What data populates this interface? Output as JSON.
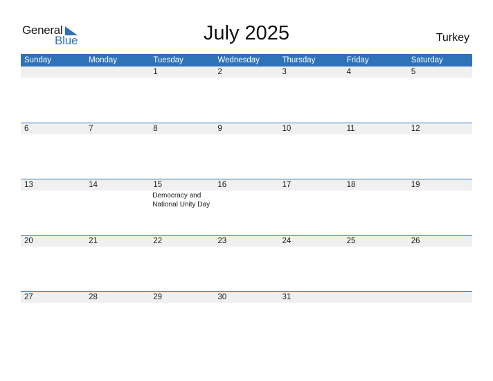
{
  "logo": {
    "general": "General",
    "blue": "Blue"
  },
  "title": "July 2025",
  "country": "Turkey",
  "colors": {
    "accent": "#2e73b8",
    "date_strip": "#f0f0f0"
  },
  "weekdays": [
    "Sunday",
    "Monday",
    "Tuesday",
    "Wednesday",
    "Thursday",
    "Friday",
    "Saturday"
  ],
  "weeks": [
    {
      "days": [
        "",
        "",
        "1",
        "2",
        "3",
        "4",
        "5"
      ],
      "events": [
        "",
        "",
        "",
        "",
        "",
        "",
        ""
      ]
    },
    {
      "days": [
        "6",
        "7",
        "8",
        "9",
        "10",
        "11",
        "12"
      ],
      "events": [
        "",
        "",
        "",
        "",
        "",
        "",
        ""
      ]
    },
    {
      "days": [
        "13",
        "14",
        "15",
        "16",
        "17",
        "18",
        "19"
      ],
      "events": [
        "",
        "",
        "Democracy and National Unity Day",
        "",
        "",
        "",
        ""
      ]
    },
    {
      "days": [
        "20",
        "21",
        "22",
        "23",
        "24",
        "25",
        "26"
      ],
      "events": [
        "",
        "",
        "",
        "",
        "",
        "",
        ""
      ]
    },
    {
      "days": [
        "27",
        "28",
        "29",
        "30",
        "31",
        "",
        ""
      ],
      "events": [
        "",
        "",
        "",
        "",
        "",
        "",
        ""
      ]
    }
  ]
}
